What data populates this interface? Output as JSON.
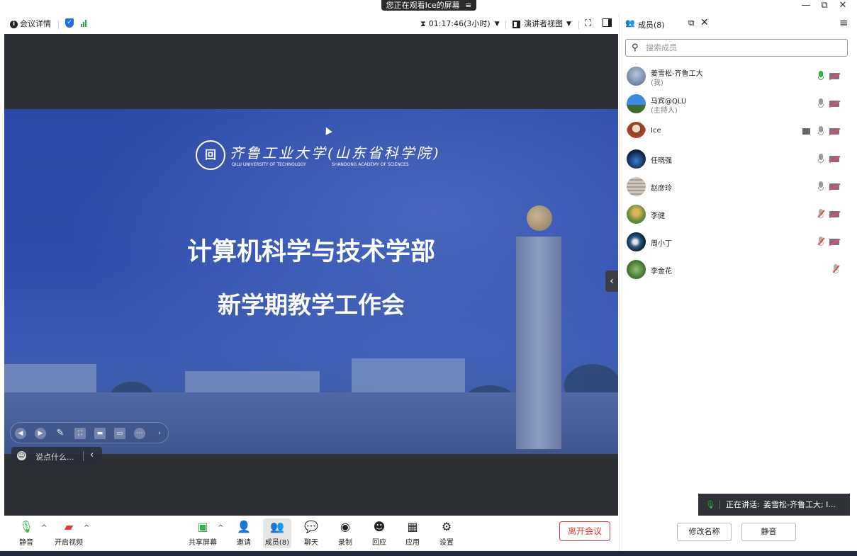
{
  "window": {
    "watch_banner": "您正在观看Ice的屏幕",
    "banner_icon": "menu-icon",
    "controls": [
      "minimize-icon",
      "restore-icon",
      "close-icon"
    ]
  },
  "top_toolbar": {
    "meeting_details": "会议详情",
    "timer": "01:17:46(3小时)",
    "view_mode": "演讲者视图"
  },
  "slide": {
    "logo_cn": "齐鲁工业大学(山东省科学院)",
    "logo_en_left": "QILU UNIVERSITY OF TECHNOLOGY",
    "logo_en_right": "SHANDONG ACADEMY OF SCIENCES",
    "title_line1": "计算机科学与技术学部",
    "title_line2": "新学期教学工作会",
    "chat_placeholder": "说点什么..."
  },
  "bottom_toolbar": {
    "mute": "静音",
    "start_video": "开启视频",
    "share_screen": "共享屏幕",
    "invite": "邀请",
    "members": "成员(8)",
    "chat": "聊天",
    "record": "录制",
    "react": "回应",
    "apps": "应用",
    "settings": "设置",
    "leave": "离开会议"
  },
  "members_panel": {
    "header": "成员(8)",
    "search_placeholder": "搜索成员",
    "members": [
      {
        "name": "姜雪松-齐鲁工大",
        "role": "(我)",
        "mic": "active",
        "camera": "off"
      },
      {
        "name": "马宾@QLU",
        "role": "(主持人)",
        "mic": "on",
        "camera": "off"
      },
      {
        "name": "Ice",
        "role": "",
        "mic": "on",
        "camera": "off",
        "sharing": true
      },
      {
        "name": "任晓强",
        "role": "",
        "mic": "on",
        "camera": "off"
      },
      {
        "name": "赵彦玲",
        "role": "",
        "mic": "on",
        "camera": "off"
      },
      {
        "name": "李健",
        "role": "",
        "mic": "muted",
        "camera": "off"
      },
      {
        "name": "周小丁",
        "role": "",
        "mic": "muted",
        "camera": "off"
      },
      {
        "name": "李金花",
        "role": "",
        "mic": "muted",
        "camera": "none"
      }
    ],
    "speaking_label": "正在讲话:",
    "speaking_names": "姜雪松-齐鲁工大; I...",
    "rename_button": "修改名称",
    "mute_button": "静音"
  },
  "colors": {
    "accent_blue": "#1f6fe0",
    "mic_green": "#2fb344",
    "leave_red": "#e03b3b",
    "slide_blue": "#2f4fae"
  }
}
